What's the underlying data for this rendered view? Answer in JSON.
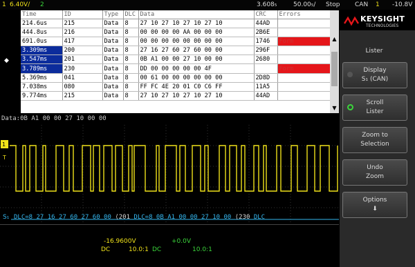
{
  "colors": {
    "ch1": "#f0e21a",
    "ch2": "#3bd63b",
    "can": "#35b7ef",
    "brand": "#e5161a",
    "selected": "#0c2c9c"
  },
  "topbar": {
    "ch1_num": "1",
    "ch1_scale": "6.40V/",
    "ch2_num": "2",
    "time_ref": "3.608₅",
    "time_scale": "50.00₅/",
    "run_state": "Stop",
    "trigger_num": "1",
    "trigger_level": "-10.8V",
    "trigger_source": "CAN"
  },
  "lister": {
    "columns": [
      "Time",
      "ID",
      "Type",
      "DLC",
      "Data",
      "CRC",
      "Errors"
    ],
    "rows": [
      {
        "time": "214.6us",
        "id": "215",
        "type": "Data",
        "dlc": "8",
        "data": "27 10 27 10 27 10 27 10",
        "crc": "44AD",
        "errors": "",
        "selected": false
      },
      {
        "time": "444.8us",
        "id": "216",
        "type": "Data",
        "dlc": "8",
        "data": "00 00 00 00 AA 00 00 00",
        "crc": "2B6E",
        "errors": "",
        "selected": false
      },
      {
        "time": "691.0us",
        "id": "417",
        "type": "Data",
        "dlc": "8",
        "data": "00 00 00 00 00 00 00 00",
        "crc": "1746",
        "errors": "Form",
        "selected": false
      },
      {
        "time": "3.309ms",
        "id": "200",
        "type": "Data",
        "dlc": "8",
        "data": "27 16 27 60 27 60 00 00",
        "crc": "296F",
        "errors": "",
        "selected": true
      },
      {
        "time": "3.547ms",
        "id": "201",
        "type": "Data",
        "dlc": "8",
        "data": "0B A1 00 00 27 10 00 00",
        "crc": "2680",
        "errors": "",
        "selected": true
      },
      {
        "time": "3.789ms",
        "id": "230",
        "type": "Data",
        "dlc": "8",
        "data": "DD 00 00 00 00 00 4F",
        "crc": "",
        "errors": "Form",
        "selected": true
      },
      {
        "time": "5.369ms",
        "id": "041",
        "type": "Data",
        "dlc": "8",
        "data": "00 61 00 00 00 00 00 00",
        "crc": "2D8D",
        "errors": "",
        "selected": false
      },
      {
        "time": "7.038ms",
        "id": "080",
        "type": "Data",
        "dlc": "8",
        "data": "FF FC 4E 20 01 C0 C6 FF",
        "crc": "11A5",
        "errors": "",
        "selected": false
      },
      {
        "time": "9.774ms",
        "id": "215",
        "type": "Data",
        "dlc": "8",
        "data": "27 10 27 10 27 10 27 10",
        "crc": "44AD",
        "errors": "",
        "selected": false
      }
    ]
  },
  "dataline": "Data:0B A1 00 00 27 10 00 00",
  "decode": {
    "channel": "S₁",
    "segments": [
      "DLC=8 27 16 27 60 27 60 00",
      "201",
      "DLC=8 0B A1 00 00 27 10 00",
      "230",
      "DLC"
    ]
  },
  "bottom": {
    "ch1_offset": "-16.9600V",
    "ch2_offset": "+0.0V",
    "ch1_coupling": "DC",
    "ch1_impedance": "10.0:1",
    "ch2_coupling": "DC",
    "ch2_impedance": "10.0:1"
  },
  "brand": {
    "name": "KEYSIGHT",
    "sub": "TECHNOLOGIES"
  },
  "menu": {
    "title": "Lister",
    "softkeys": [
      {
        "line1": "Display",
        "line2": "S₁ (CAN)"
      },
      {
        "line1": "Scroll",
        "line2": "Lister"
      },
      {
        "line1": "Zoom to",
        "line2": "Selection"
      },
      {
        "line1": "Undo",
        "line2": "Zoom"
      },
      {
        "line1": "Options",
        "line2": "⬇"
      }
    ]
  },
  "icons": {
    "up": "▲",
    "down": "▼",
    "marker": "◆"
  }
}
